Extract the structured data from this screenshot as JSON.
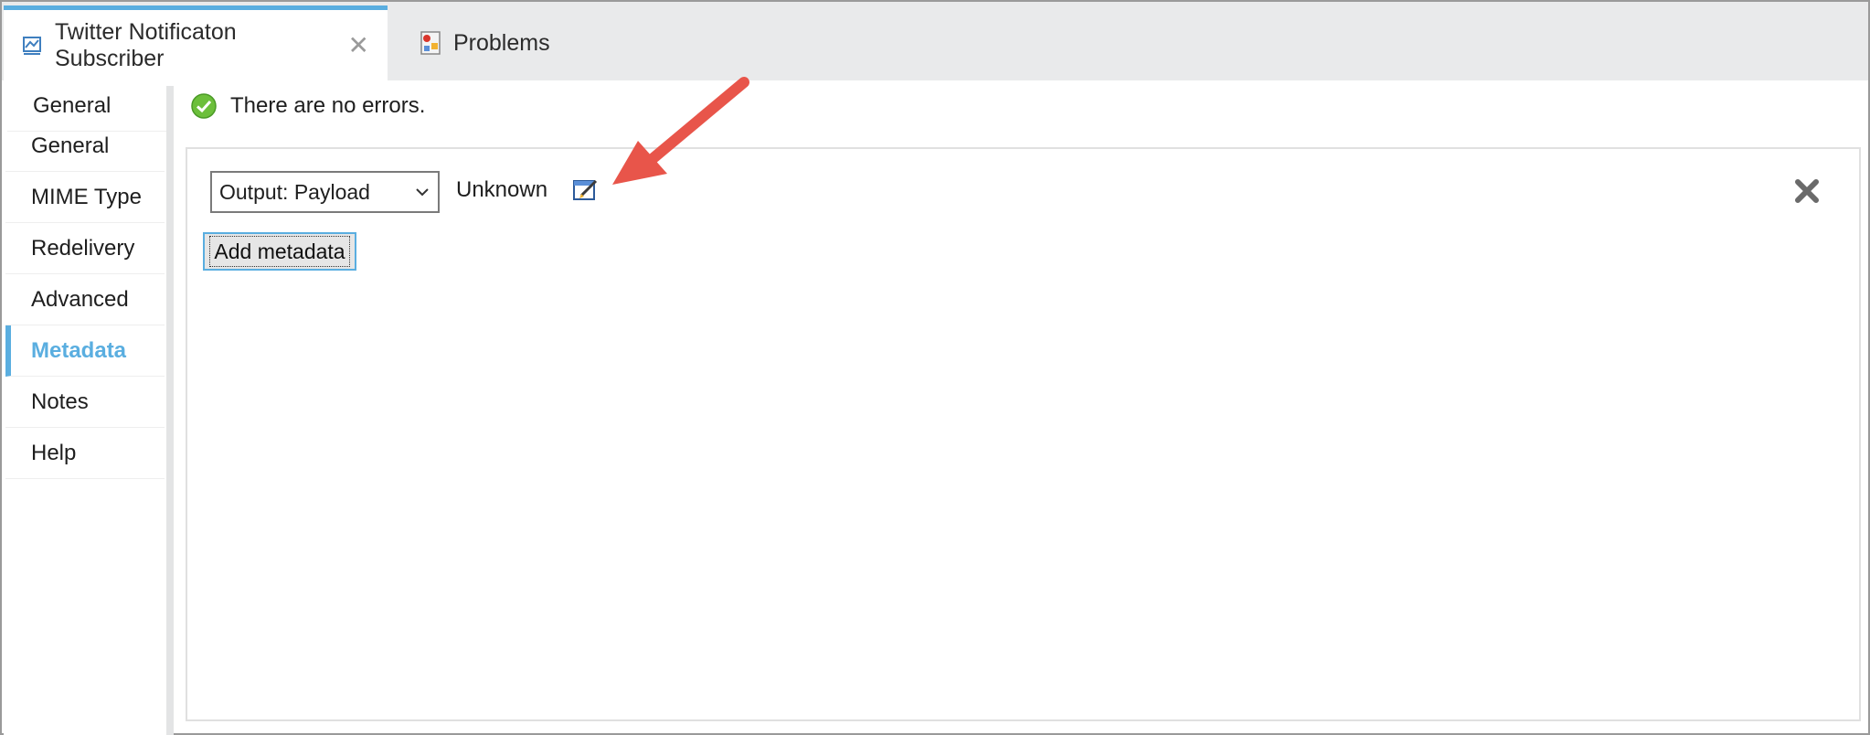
{
  "tabs": [
    {
      "label": "Twitter Notificaton Subscriber",
      "icon": "flow-icon",
      "active": true
    },
    {
      "label": "Problems",
      "icon": "problems-icon",
      "active": false
    }
  ],
  "nav": {
    "items": [
      {
        "label": "General"
      },
      {
        "label": "MIME Type"
      },
      {
        "label": "Redelivery"
      },
      {
        "label": "Advanced"
      },
      {
        "label": "Metadata",
        "selected": true
      },
      {
        "label": "Notes"
      },
      {
        "label": "Help"
      }
    ]
  },
  "status": {
    "text": "There are no errors.",
    "icon": "check-circle-icon"
  },
  "metadata": {
    "select_value": "Output: Payload",
    "type_label": "Unknown",
    "add_button": "Add metadata"
  },
  "colors": {
    "accent": "#5aaee0",
    "annotation_arrow": "#e8554a",
    "ok": "#6cbf3b"
  }
}
